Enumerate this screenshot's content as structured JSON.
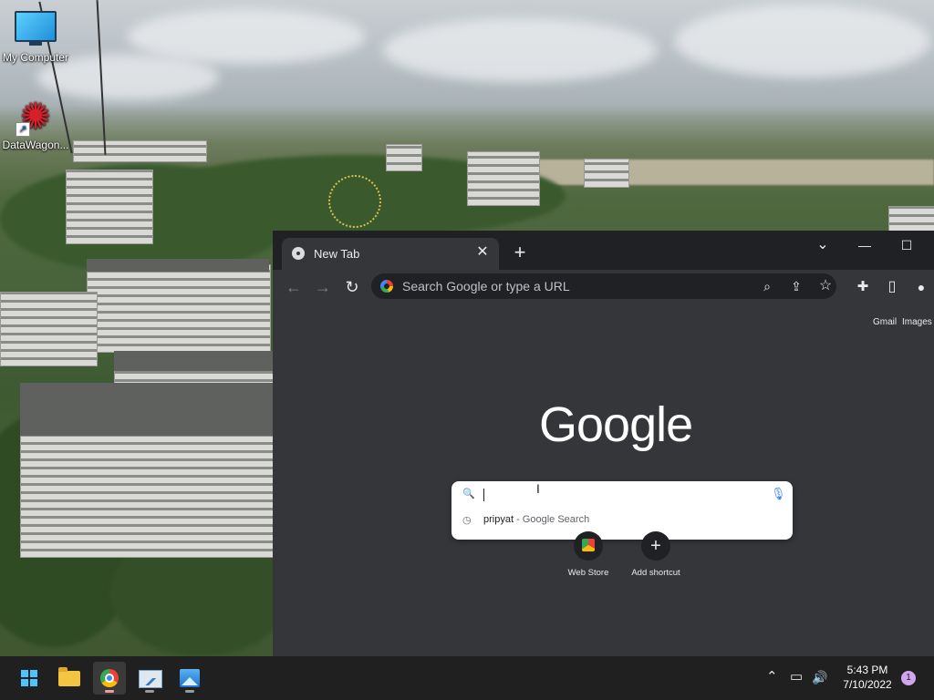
{
  "desktop": {
    "icons": [
      {
        "label": "My Computer",
        "icon": "monitor-icon"
      },
      {
        "label": "DataWagon...",
        "icon": "datawagon-shortcut-icon"
      }
    ]
  },
  "chrome": {
    "tab": {
      "title": "New Tab",
      "close": "✕"
    },
    "new_tab": "+",
    "window_controls": {
      "tab_search": "⌄",
      "minimize": "—",
      "maximize": "☐"
    },
    "toolbar": {
      "back": "←",
      "forward": "→",
      "reload": "↻",
      "omnibox_placeholder": "Search Google or type a URL",
      "zoom": "⌕",
      "share": "⇪",
      "bookmark": "☆",
      "extensions": "✚",
      "side_panel": "▯",
      "profile": "●"
    },
    "ntp": {
      "links": [
        "Gmail",
        "Images"
      ],
      "logo": "Google",
      "search_input_value": "",
      "suggestion": {
        "query": "pripyat",
        "description": " - Google Search"
      },
      "shortcuts": [
        {
          "label": "Web Store",
          "icon": "web-store-icon"
        },
        {
          "label": "Add shortcut",
          "icon": "plus-icon",
          "glyph": "+"
        }
      ]
    }
  },
  "taskbar": {
    "apps": [
      "start-icon",
      "file-explorer-icon",
      "chrome-icon",
      "chart-app-icon",
      "photos-icon"
    ],
    "tray": {
      "chevron": "⌃",
      "network": "▭",
      "volume": "🔊"
    },
    "time": "5:43 PM",
    "date": "7/10/2022",
    "notification_count": "1"
  }
}
